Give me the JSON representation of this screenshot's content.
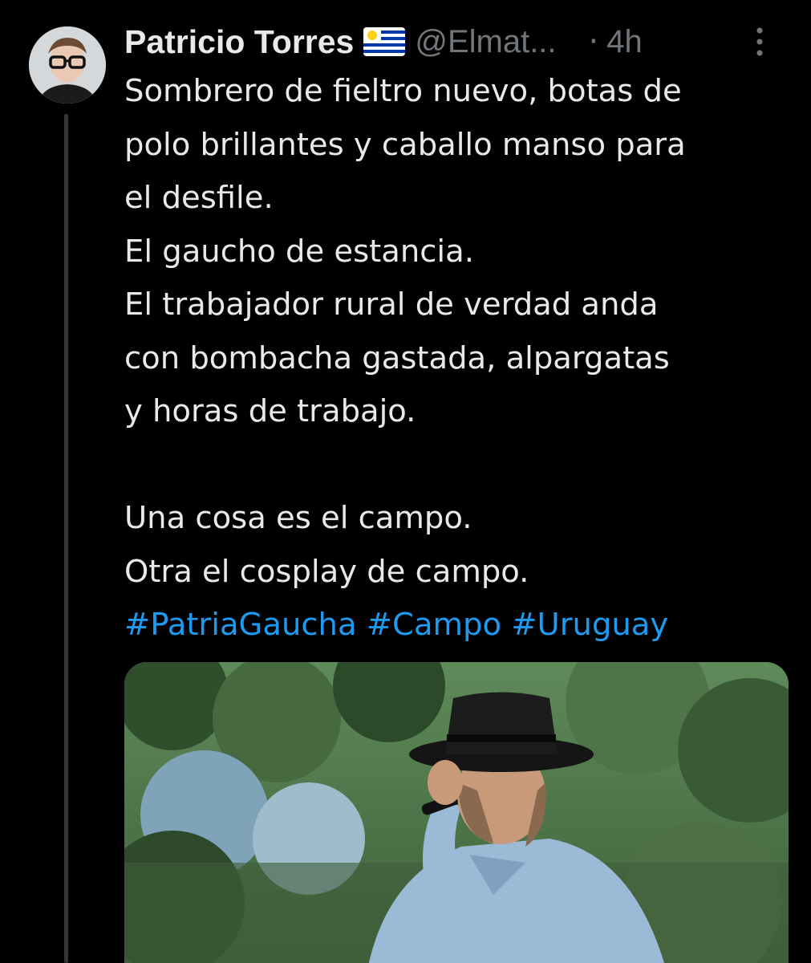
{
  "tweet": {
    "author": {
      "display_name": "Patricio Torres",
      "flag_icon": "uruguay-flag-icon",
      "handle": "@Elmat...",
      "separator": "·",
      "time": "4h"
    },
    "more_icon": "more-vertical-icon",
    "lines": [
      "Sombrero de fieltro nuevo, botas de",
      "polo brillantes y caballo manso para",
      "el desfile.",
      "El gaucho de estancia.",
      "El trabajador rural de verdad anda",
      "con bombacha gastada, alpargatas",
      "y horas de trabajo.",
      "",
      "Una cosa es el campo.",
      "Otra el cosplay de campo."
    ],
    "hashtags": [
      "#PatriaGaucha",
      "#Campo",
      "#Uruguay"
    ]
  },
  "colors": {
    "background": "#000000",
    "text": "#e7e9ea",
    "secondary": "#71767b",
    "link": "#1d9bf0",
    "thread_line": "#333639"
  }
}
